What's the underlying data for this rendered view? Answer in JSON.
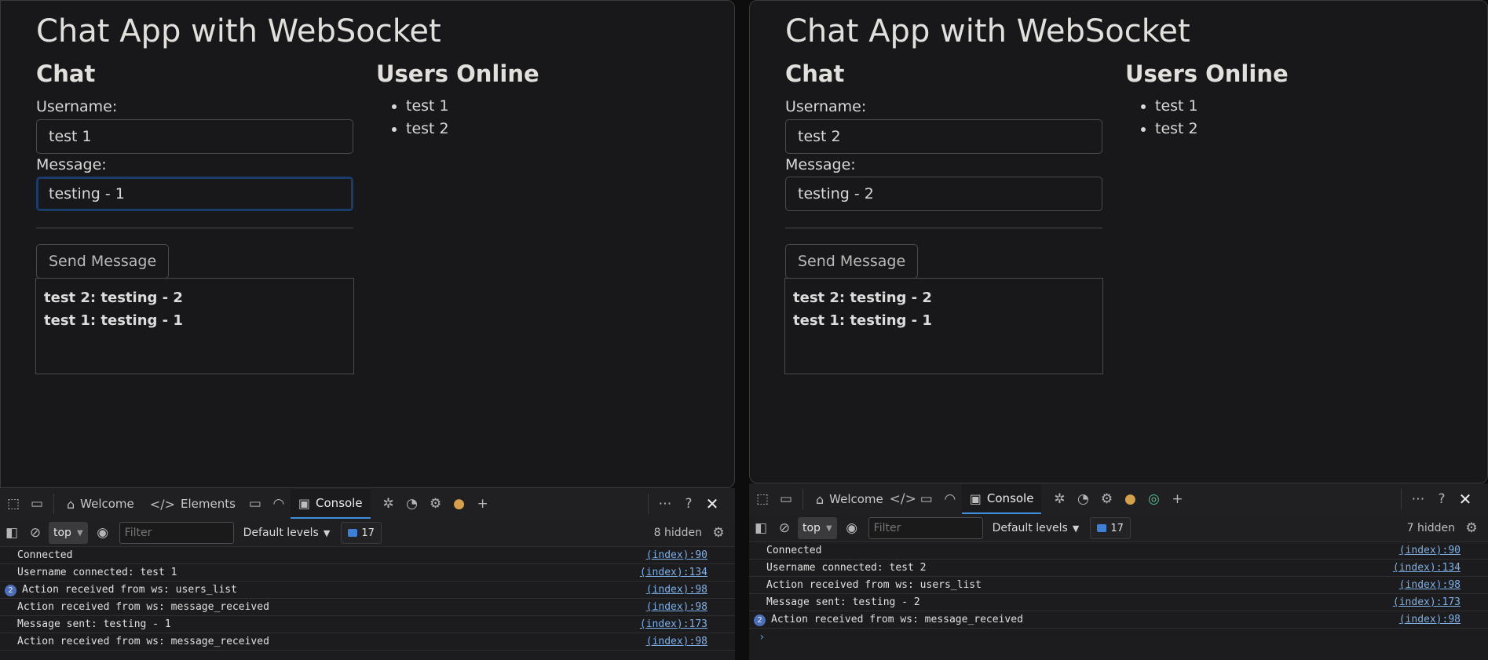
{
  "left": {
    "app_title": "Chat App with WebSocket",
    "chat_heading": "Chat",
    "users_heading": "Users Online",
    "username_label": "Username:",
    "username_value": "test 1",
    "message_label": "Message:",
    "message_value": "testing - 1",
    "send_label": "Send Message",
    "messages": [
      "test 2: testing - 2",
      "test 1: testing - 1"
    ],
    "users": [
      "test 1",
      "test 2"
    ],
    "devtools": {
      "tabs": {
        "welcome": "Welcome",
        "elements": "Elements",
        "console": "Console"
      },
      "context": "top",
      "filter_placeholder": "Filter",
      "levels": "Default levels",
      "message_count": "17",
      "hidden": "8 hidden",
      "logs": [
        {
          "text": "Connected",
          "src": "(index):90",
          "badge": ""
        },
        {
          "text": "Username connected: test 1",
          "src": "(index):134",
          "badge": ""
        },
        {
          "text": "Action received from ws: users_list",
          "src": "(index):98",
          "badge": "2"
        },
        {
          "text": "Action received from ws: message_received",
          "src": "(index):98",
          "badge": ""
        },
        {
          "text": "Message sent: testing - 1",
          "src": "(index):173",
          "badge": ""
        },
        {
          "text": "Action received from ws: message_received",
          "src": "(index):98",
          "badge": ""
        }
      ]
    }
  },
  "right": {
    "app_title": "Chat App with WebSocket",
    "chat_heading": "Chat",
    "users_heading": "Users Online",
    "username_label": "Username:",
    "username_value": "test 2",
    "message_label": "Message:",
    "message_value": "testing - 2",
    "send_label": "Send Message",
    "messages": [
      "test 2: testing - 2",
      "test 1: testing - 1"
    ],
    "users": [
      "test 1",
      "test 2"
    ],
    "devtools": {
      "tabs": {
        "welcome": "Welcome",
        "console": "Console"
      },
      "context": "top",
      "filter_placeholder": "Filter",
      "levels": "Default levels",
      "message_count": "17",
      "hidden": "7 hidden",
      "logs": [
        {
          "text": "Connected",
          "src": "(index):90",
          "badge": ""
        },
        {
          "text": "Username connected: test 2",
          "src": "(index):134",
          "badge": ""
        },
        {
          "text": "Action received from ws: users_list",
          "src": "(index):98",
          "badge": ""
        },
        {
          "text": "Message sent: testing - 2",
          "src": "(index):173",
          "badge": ""
        },
        {
          "text": "Action received from ws: message_received",
          "src": "(index):98",
          "badge": "2"
        }
      ],
      "prompt": "›"
    }
  },
  "icons": {
    "inspect": "inspect-icon",
    "device": "device-emulation-icon",
    "home": "home-icon",
    "code": "code-icon",
    "sources": "sources-icon",
    "wifi": "network-icon",
    "console": "console-icon",
    "bug": "bug-icon",
    "performance": "performance-icon",
    "memory": "memory-icon",
    "cookie": "cookie-icon",
    "add": "add-tab-icon",
    "more": "more-icon",
    "help": "help-icon",
    "close": "close-icon"
  }
}
